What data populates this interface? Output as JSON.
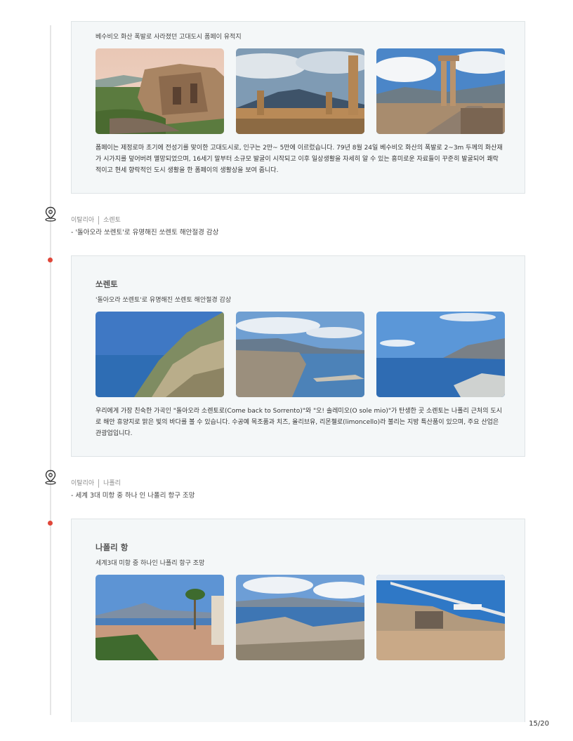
{
  "pompeii": {
    "subtitle": "베수비오 화산 폭발로 사라졌던 고대도시 폼페이 유적지",
    "body": "폼페이는 제정로마 초기에 전성기를 맞이한 고대도시로, 인구는 2만~ 5만에 이르렀습니다. 79년 8월 24일 베수비오 화산의 폭발로 2~3m 두께의 화산재가 시가지를 덮어버려 멸망되었으며, 16세기 말부터 소규모 발굴이 시작되고 이후 일상생활을 자세히 알 수 있는 흥미로운 자료들이 꾸준히 발굴되어 쾌락적이고 현세 향락적인 도시 생활을 한 폼페이의 생활상을 보여 줍니다."
  },
  "stops": [
    {
      "country": "이탈리아",
      "city": "소렌토",
      "desc": "- '돌아오라 쏘렌토'로 유명해진 쏘렌토 해안절경 감상"
    },
    {
      "country": "이탈리아",
      "city": "나폴리",
      "desc": "- 세계 3대 미항 중 하나 인 나폴리 항구 조망"
    }
  ],
  "sorrento": {
    "title": "쏘렌토",
    "subtitle": "'돌아오라 쏘렌토'로 유명해진 쏘렌토 해안절경 감상",
    "body": "우리에게 가장 친숙한 가곡인 \"돌아오라 소렌토로(Come back to Sorrento)\"와 \"오! 솔레미오(O sole mio)\"가 탄생한 곳 소렌토는 나폴리 근처의 도시로 해안 휴양지로 맑은 빛의 바다를 볼 수 있습니다. 수공예 목조품과 치즈, 올리브유, 리몬첼로(limoncello)라 불리는 지방 특산품이 있으며, 주요 산업은 관광업입니다."
  },
  "naples": {
    "title": "나폴리 항",
    "subtitle": "세계3대 미항 중 하나인 나폴리 항구 조망"
  },
  "page_number": "15/20",
  "colors": {
    "dot": "#e0473a",
    "card_bg": "#f4f7f8"
  }
}
